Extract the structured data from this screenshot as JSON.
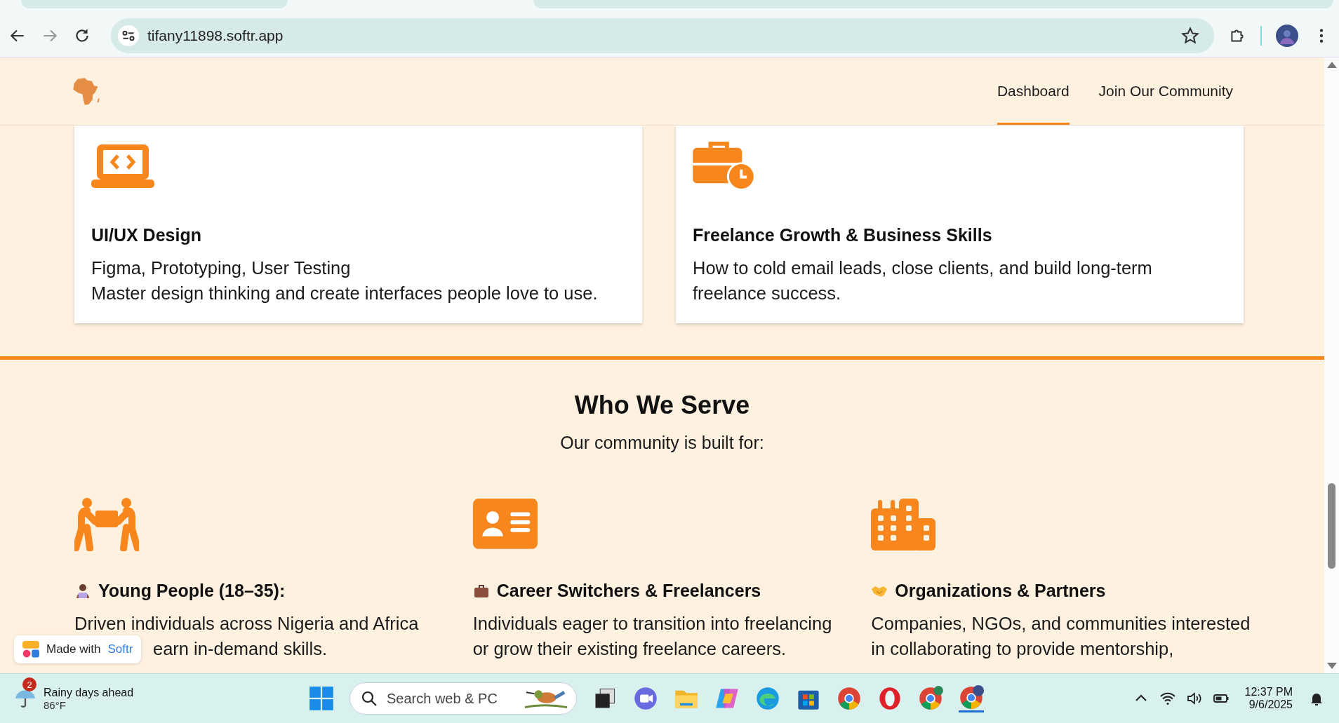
{
  "browser": {
    "url": "tifany11898.softr.app"
  },
  "nav": {
    "items": [
      {
        "label": "Dashboard",
        "selected": true
      },
      {
        "label": "Join Our Community",
        "selected": false
      }
    ]
  },
  "skill_cards": [
    {
      "kind": "laptop-code",
      "title": "UI/UX Design",
      "lines": [
        "Figma, Prototyping, User Testing",
        "Master design thinking and create interfaces people love to use."
      ]
    },
    {
      "kind": "briefcase-clock",
      "title": "Freelance Growth & Business Skills",
      "lines": [
        "How to cold email leads, close clients, and build long-term freelance success."
      ]
    }
  ],
  "serve": {
    "title": "Who We Serve",
    "subtitle": "Our community is built for:"
  },
  "audiences": [
    {
      "kind": "people",
      "title": "Young People (18–35):",
      "lines": [
        "Driven individuals across Nigeria and Africa",
        "earn in-demand skills."
      ]
    },
    {
      "kind": "id-card",
      "title": "Career Switchers & Freelancers",
      "lines": [
        "Individuals eager to transition into freelancing",
        "or grow their existing freelance careers."
      ]
    },
    {
      "kind": "buildings",
      "title": "Organizations & Partners",
      "lines": [
        "Companies, NGOs, and communities interested",
        "in collaborating to provide mentorship,"
      ]
    }
  ],
  "badge": {
    "prefix": "Made with",
    "brand": "Softr"
  },
  "taskbar": {
    "weather_alerts": "2",
    "weather_title": "Rainy days ahead",
    "temperature": "86°F",
    "search_placeholder": "Search web & PC",
    "time": "12:37 PM",
    "date": "9/6/2025"
  }
}
